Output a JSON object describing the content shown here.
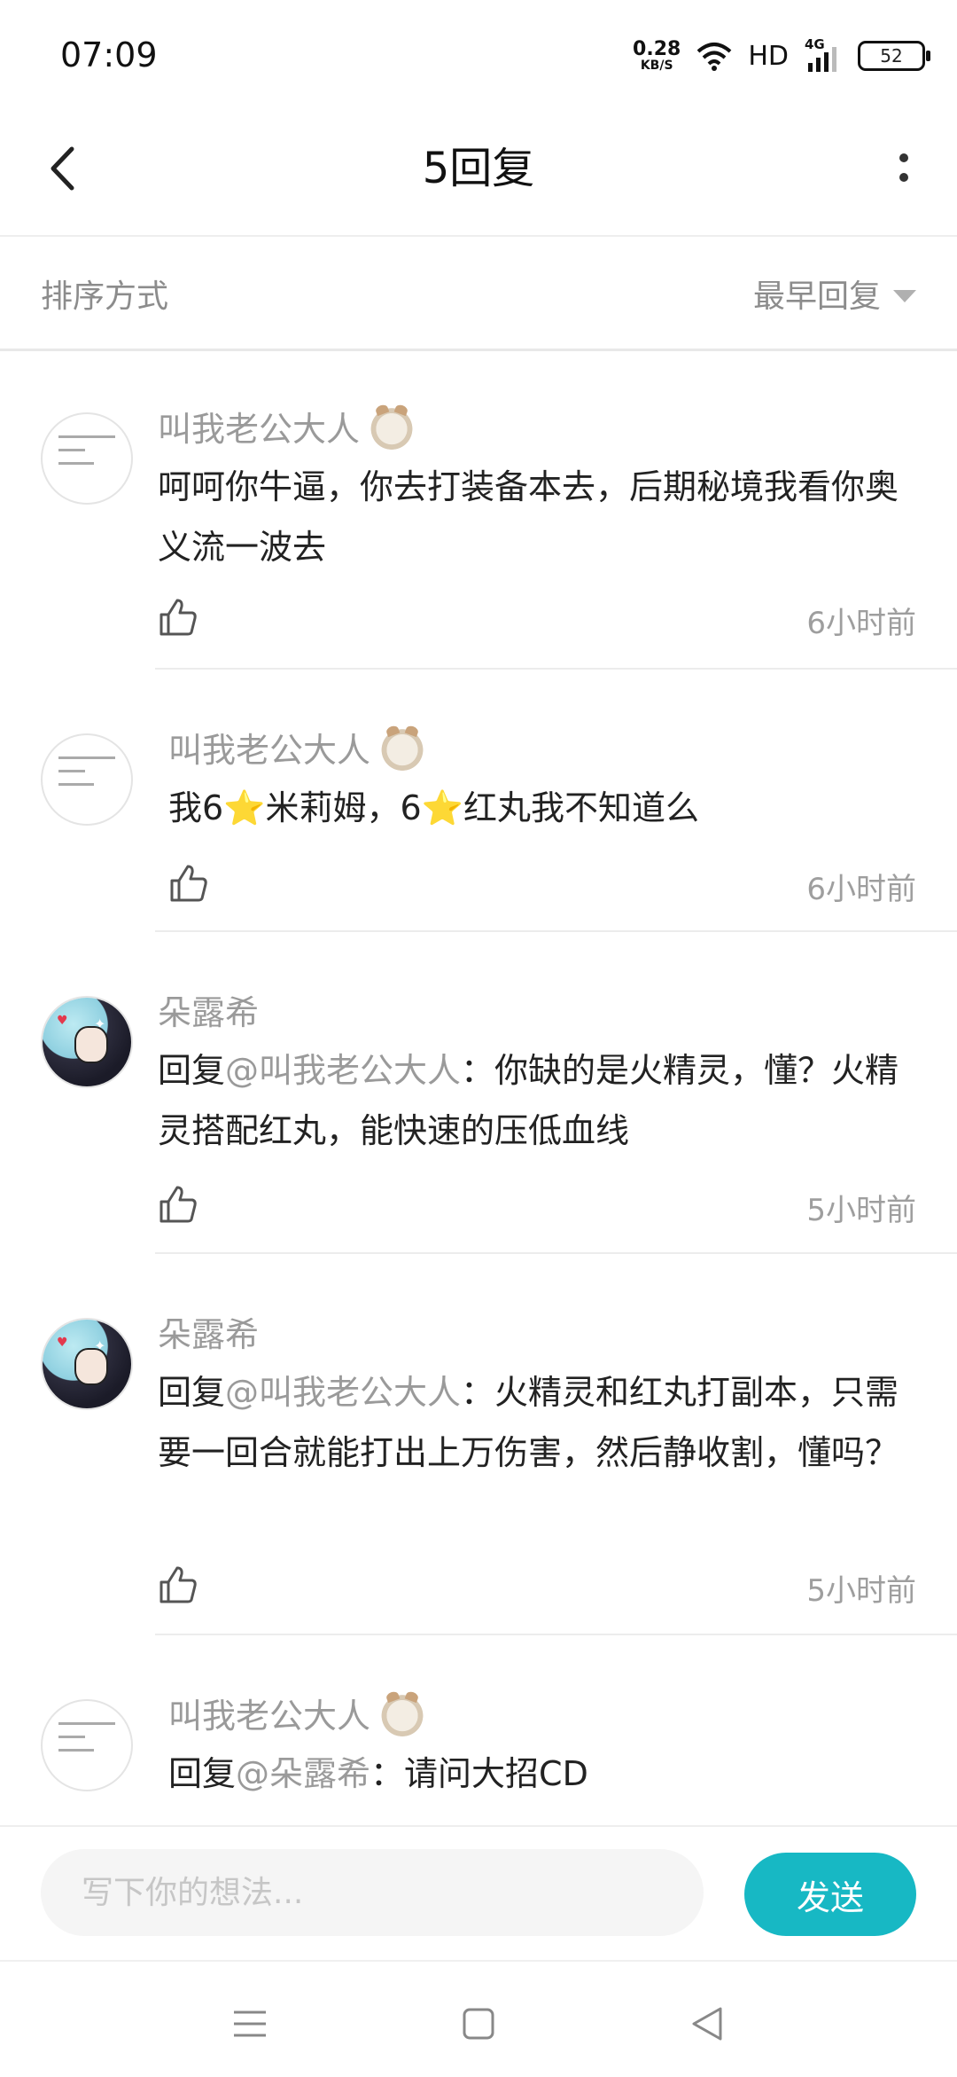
{
  "status_bar": {
    "time": "07:09",
    "net_speed_value": "0.28",
    "net_speed_unit": "KB/S",
    "hd": "HD",
    "network": "4G",
    "battery": "52"
  },
  "header": {
    "title": "5回复"
  },
  "sort": {
    "label": "排序方式",
    "selected": "最早回复"
  },
  "replies": [
    {
      "username": "叫我老公大人",
      "text": "呵呵你牛逼，你去打装备本去，后期秘境我看你奥义流一波去",
      "time": "6小时前"
    },
    {
      "username": "叫我老公大人",
      "text_parts": [
        "我6",
        "⭐",
        "米莉姆，6",
        "⭐",
        "红丸我不知道么"
      ],
      "time": "6小时前"
    },
    {
      "username": "朵露希",
      "reply_prefix": "回复",
      "mention": "@叫我老公大人",
      "text": "：你缺的是火精灵，懂？火精灵搭配红丸，能快速的压低血线",
      "time": "5小时前"
    },
    {
      "username": "朵露希",
      "reply_prefix": "回复",
      "mention": "@叫我老公大人",
      "text": "：火精灵和红丸打副本，只需要一回合就能打出上万伤害，然后静收割，懂吗？",
      "time": "5小时前"
    },
    {
      "username": "叫我老公大人",
      "reply_prefix": "回复",
      "mention": "@朵露希",
      "text": "：请问大招CD"
    }
  ],
  "composer": {
    "placeholder": "写下你的想法...",
    "send_label": "发送"
  },
  "colors": {
    "accent": "#17b8c4",
    "muted_text": "#9a9a9a",
    "star": "#f5b400"
  }
}
